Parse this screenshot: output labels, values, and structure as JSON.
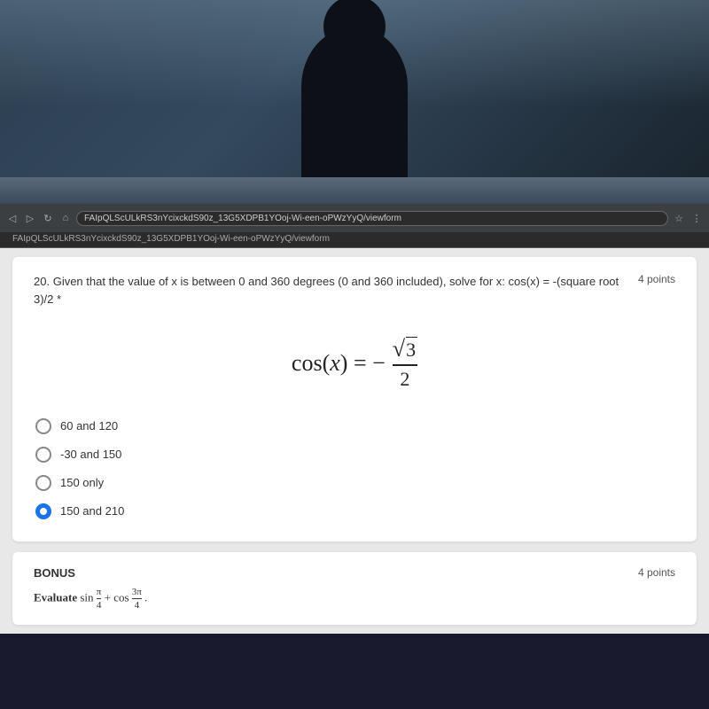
{
  "webcam": {
    "visible": true
  },
  "browser": {
    "address": "FAIpQLScULkRS3nYcixckdS90z_13G5XDPB1YOoj-Wi-een-oPWzYyQ/viewform",
    "toolbar_icons": [
      "back",
      "forward",
      "refresh",
      "home",
      "tabs",
      "extensions",
      "bookmark"
    ]
  },
  "question20": {
    "number": "20.",
    "text": "Given that the value of x is between 0 and 360 degrees (0 and 360 included), solve for x: cos(x) = -(square root 3)/2",
    "asterisk": "*",
    "points": "4 points",
    "formula_display": "cos(x) = -√3/2",
    "options": [
      {
        "id": "opt1",
        "label": "60 and 120",
        "selected": false
      },
      {
        "id": "opt2",
        "label": "-30 and 150",
        "selected": false
      },
      {
        "id": "opt3",
        "label": "150 only",
        "selected": false
      },
      {
        "id": "opt4",
        "label": "150 and 210",
        "selected": true
      }
    ]
  },
  "bonus": {
    "title": "BONUS",
    "points": "4 points",
    "text": "Evaluate sin π/4 + cos 3π/4."
  }
}
